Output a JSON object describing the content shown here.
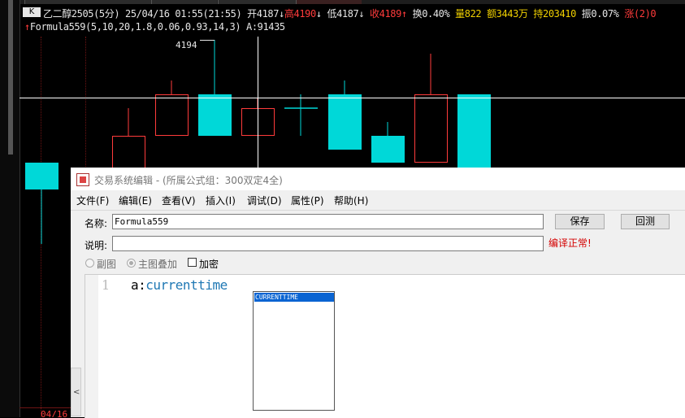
{
  "chart": {
    "k_button": "K",
    "header": {
      "symbol_period": "乙二醇2505(5分)",
      "datetime": "25/04/16 01:55(21:55)",
      "open": "开4187",
      "high": "高4190",
      "low": "低4187",
      "close": "收4189",
      "turnover": "换0.40%",
      "volume": "量822",
      "amount": "额3443万",
      "position": "持203410",
      "amplitude": "振0.07%",
      "change": "涨(2)0"
    },
    "formula_line": "Formula559(5,10,20,1.8,0.06,0.93,14,3) A:91435",
    "price_label": "4194",
    "bottom_date": "04/16",
    "colors": {
      "up": "#ff3b3b",
      "down": "#00d8d8",
      "text": "#e6e6e6",
      "volume_yellow": "#f0d000"
    }
  },
  "dialog": {
    "title": "交易系统编辑 - (所属公式组：300双定4全)",
    "menu": [
      "文件(F)",
      "编辑(E)",
      "查看(V)",
      "插入(I)",
      "调试(D)",
      "属性(P)",
      "帮助(H)"
    ],
    "name_label": "名称:",
    "name_value": "Formula559",
    "desc_label": "说明:",
    "desc_value": "",
    "save_button": "保存",
    "reply_button": "回测",
    "status": "编译正常!",
    "options": {
      "sub_chart": "副图",
      "main_overlay": "主图叠加",
      "encrypt": "加密"
    },
    "editor": {
      "line_number": "1",
      "code_prefix": "a:",
      "code_function": "currenttime"
    },
    "autocomplete": [
      "CURRENTTIME"
    ]
  }
}
